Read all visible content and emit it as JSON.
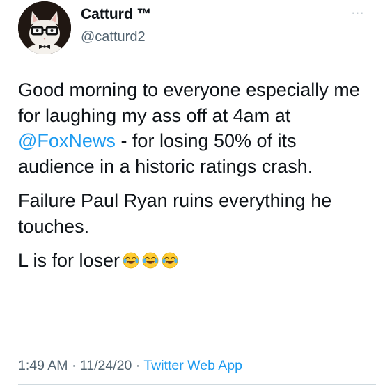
{
  "header": {
    "display_name": "Catturd ™",
    "handle": "@catturd2",
    "avatar_icon": "cat-with-glasses-avatar",
    "more_label": "···"
  },
  "tweet": {
    "p1_before": "Good morning to everyone especially me for laughing my ass off at 4am at ",
    "p1_mention": "@FoxNews",
    "p1_after": " - for losing 50% of its audience in a historic ratings crash.",
    "p2": "Failure Paul Ryan ruins everything he touches.",
    "p3": "L is for loser",
    "emojis": [
      "face-with-tears-of-joy",
      "face-with-tears-of-joy",
      "face-with-tears-of-joy"
    ]
  },
  "meta": {
    "time": "1:49 AM",
    "sep1": " · ",
    "date": "11/24/20",
    "sep2": " · ",
    "source": "Twitter Web App"
  },
  "colors": {
    "link": "#1d9bf0",
    "secondary_text": "#536471",
    "primary_text": "#0f1419"
  }
}
